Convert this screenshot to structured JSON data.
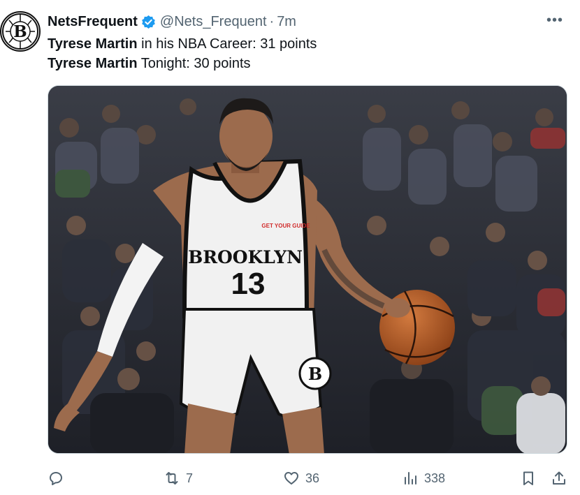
{
  "account": {
    "display_name": "NetsFrequent",
    "handle": "@Nets_Frequent",
    "separator": "·",
    "time": "7m",
    "avatar_icon": "brooklyn-nets-logo",
    "avatar_letter": "B"
  },
  "menu": {
    "more_label": "•••"
  },
  "tweet": {
    "lines": [
      {
        "name": "Tyrese Martin",
        "rest": " in his NBA Career: 31 points"
      },
      {
        "name": "Tyrese Martin",
        "rest": " Tonight: 30 points"
      }
    ]
  },
  "media": {
    "jersey_team": "BROOKLYN",
    "jersey_number": "13",
    "jersey_patch": "GET YOUR GUIDE",
    "shorts_logo": "B"
  },
  "actions": {
    "reply": {
      "icon": "reply-icon",
      "count": ""
    },
    "repost": {
      "icon": "repost-icon",
      "count": "7"
    },
    "like": {
      "icon": "heart-icon",
      "count": "36"
    },
    "views": {
      "icon": "views-icon",
      "count": "338"
    },
    "bookmark": {
      "icon": "bookmark-icon"
    },
    "share": {
      "icon": "share-icon"
    }
  },
  "colors": {
    "verified": "#1d9bf0",
    "secondary_text": "#536471",
    "primary_text": "#0f1419"
  }
}
